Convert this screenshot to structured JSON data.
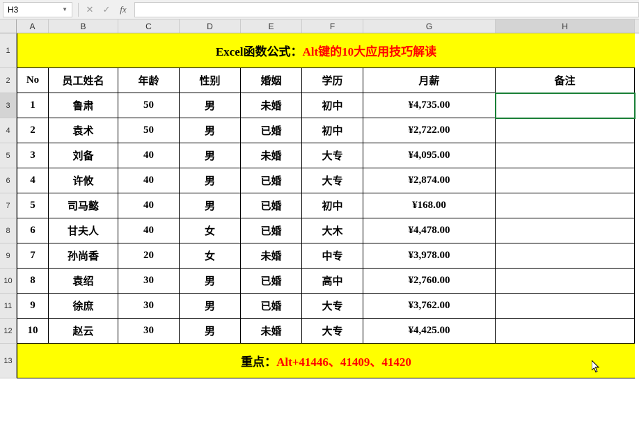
{
  "formulaBar": {
    "nameBox": "H3",
    "fxValue": ""
  },
  "columnLetters": [
    "A",
    "B",
    "C",
    "D",
    "E",
    "F",
    "G",
    "H"
  ],
  "rowNumbers": [
    "1",
    "2",
    "3",
    "4",
    "5",
    "6",
    "7",
    "8",
    "9",
    "10",
    "11",
    "12",
    "13"
  ],
  "activeColumn": "H",
  "activeRow": "3",
  "title": {
    "part1": "Excel函数公式：",
    "part2": "Alt键的10大应用技巧解读"
  },
  "headers": {
    "no": "No",
    "name": "员工姓名",
    "age": "年龄",
    "gender": "性别",
    "marriage": "婚姻",
    "education": "学历",
    "salary": "月薪",
    "remark": "备注"
  },
  "rows": [
    {
      "no": "1",
      "name": "鲁肃",
      "age": "50",
      "gender": "男",
      "marriage": "未婚",
      "education": "初中",
      "salary": "¥4,735.00",
      "remark": ""
    },
    {
      "no": "2",
      "name": "袁术",
      "age": "50",
      "gender": "男",
      "marriage": "已婚",
      "education": "初中",
      "salary": "¥2,722.00",
      "remark": ""
    },
    {
      "no": "3",
      "name": "刘备",
      "age": "40",
      "gender": "男",
      "marriage": "未婚",
      "education": "大专",
      "salary": "¥4,095.00",
      "remark": ""
    },
    {
      "no": "4",
      "name": "许攸",
      "age": "40",
      "gender": "男",
      "marriage": "已婚",
      "education": "大专",
      "salary": "¥2,874.00",
      "remark": ""
    },
    {
      "no": "5",
      "name": "司马懿",
      "age": "40",
      "gender": "男",
      "marriage": "已婚",
      "education": "初中",
      "salary": "¥168.00",
      "remark": ""
    },
    {
      "no": "6",
      "name": "甘夫人",
      "age": "40",
      "gender": "女",
      "marriage": "已婚",
      "education": "大木",
      "salary": "¥4,478.00",
      "remark": ""
    },
    {
      "no": "7",
      "name": "孙尚香",
      "age": "20",
      "gender": "女",
      "marriage": "未婚",
      "education": "中专",
      "salary": "¥3,978.00",
      "remark": ""
    },
    {
      "no": "8",
      "name": "袁绍",
      "age": "30",
      "gender": "男",
      "marriage": "已婚",
      "education": "高中",
      "salary": "¥2,760.00",
      "remark": ""
    },
    {
      "no": "9",
      "name": "徐庶",
      "age": "30",
      "gender": "男",
      "marriage": "已婚",
      "education": "大专",
      "salary": "¥3,762.00",
      "remark": ""
    },
    {
      "no": "10",
      "name": "赵云",
      "age": "30",
      "gender": "男",
      "marriage": "未婚",
      "education": "大专",
      "salary": "¥4,425.00",
      "remark": ""
    }
  ],
  "footer": {
    "part1": "重点：",
    "part2": "Alt+41446、41409、41420"
  },
  "chart_data": {
    "type": "table",
    "title": "Excel函数公式：Alt键的10大应用技巧解读",
    "columns": [
      "No",
      "员工姓名",
      "年龄",
      "性别",
      "婚姻",
      "学历",
      "月薪",
      "备注"
    ],
    "data": [
      [
        1,
        "鲁肃",
        50,
        "男",
        "未婚",
        "初中",
        4735.0,
        ""
      ],
      [
        2,
        "袁术",
        50,
        "男",
        "已婚",
        "初中",
        2722.0,
        ""
      ],
      [
        3,
        "刘备",
        40,
        "男",
        "未婚",
        "大专",
        4095.0,
        ""
      ],
      [
        4,
        "许攸",
        40,
        "男",
        "已婚",
        "大专",
        2874.0,
        ""
      ],
      [
        5,
        "司马懿",
        40,
        "男",
        "已婚",
        "初中",
        168.0,
        ""
      ],
      [
        6,
        "甘夫人",
        40,
        "女",
        "已婚",
        "大木",
        4478.0,
        ""
      ],
      [
        7,
        "孙尚香",
        20,
        "女",
        "未婚",
        "中专",
        3978.0,
        ""
      ],
      [
        8,
        "袁绍",
        30,
        "男",
        "已婚",
        "高中",
        2760.0,
        ""
      ],
      [
        9,
        "徐庶",
        30,
        "男",
        "已婚",
        "大专",
        3762.0,
        ""
      ],
      [
        10,
        "赵云",
        30,
        "男",
        "未婚",
        "大专",
        4425.0,
        ""
      ]
    ],
    "footer_note": "重点：Alt+41446、41409、41420"
  }
}
